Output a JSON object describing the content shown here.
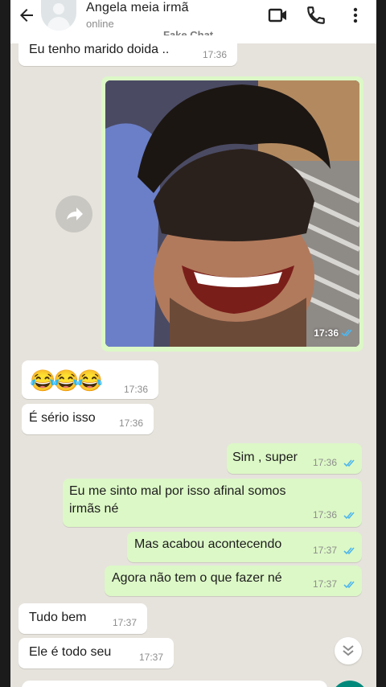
{
  "header": {
    "contact_name": "Angela meia irmã",
    "status": "online",
    "watermark": "Fake Chat",
    "icons": [
      "back-arrow-icon",
      "avatar",
      "video-call-icon",
      "phone-icon",
      "more-vertical-icon"
    ]
  },
  "colors": {
    "incoming_bubble": "#ffffff",
    "outgoing_bubble": "#dcf8c6",
    "read_ticks": "#4fb6ec",
    "chat_background": "#e6e3dc"
  },
  "messages": [
    {
      "text": "Eu tenho marido doida ..",
      "time": "17:36",
      "direction": "in"
    },
    {
      "type": "image",
      "time": "17:36",
      "direction": "out",
      "status": "read"
    },
    {
      "text": "😂😂😂",
      "time": "17:36",
      "direction": "in"
    },
    {
      "text": "É sério isso",
      "time": "17:36",
      "direction": "in"
    },
    {
      "text": "Sim , super",
      "time": "17:36",
      "direction": "out",
      "status": "read"
    },
    {
      "text_lines": [
        "Eu me sinto mal por isso afinal somos",
        "irmãs né"
      ],
      "time": "17:36",
      "direction": "out",
      "status": "read"
    },
    {
      "text": "Mas acabou acontecendo",
      "time": "17:37",
      "direction": "out",
      "status": "read"
    },
    {
      "text": "Agora não tem o que fazer né",
      "time": "17:37",
      "direction": "out",
      "status": "read"
    },
    {
      "text": "Tudo bem",
      "time": "17:37",
      "direction": "in"
    },
    {
      "text": "Ele é todo seu",
      "time": "17:37",
      "direction": "in"
    }
  ]
}
